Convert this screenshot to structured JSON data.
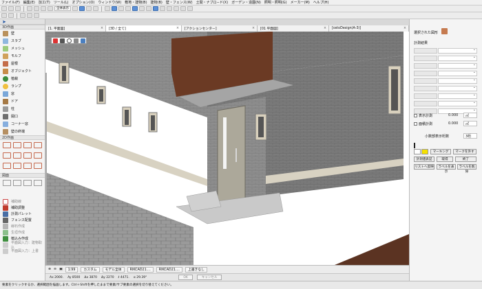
{
  "menu": [
    "ファイル(F)",
    "編集(E)",
    "加工(T)",
    "ツール(L)",
    "オプション(O)",
    "ウィンドウ(W)",
    "敷地・建物(B)",
    "建物(B)",
    "壁・フェンス(W)",
    "土間・ナブロ−ド(X)",
    "ガーデン・造園(N)",
    "照明・照明(G)",
    "メーカー(M)",
    "ヘルプ(H)"
  ],
  "toolbar": {
    "zoom_label": "全体表示"
  },
  "toolbox": {
    "header": "矢印",
    "section_3d": "3D作画",
    "tools_3d": [
      "壁",
      "スラブ",
      "メッシュ",
      "モルフ",
      "屋根",
      "オブジェクト",
      "植栽",
      "ランプ",
      "窓",
      "ドア",
      "柱",
      "開口",
      "コーナー窓",
      "壁の終端"
    ],
    "section_2d": "2D作画",
    "section_dim": "図面",
    "tools_bottom": [
      "補助線",
      "補助調整",
      "計測パレット",
      "フェンス配置",
      "線石作成",
      "生垣作成",
      "植込み作成",
      "平面図入力：建物取込",
      "平面図入力：上書"
    ]
  },
  "tabs": [
    {
      "label": "[1. 平面図]"
    },
    {
      "label": "[3D / 全て]"
    },
    {
      "label": "[アクションセンター]"
    },
    {
      "label": "[01 平面図]"
    },
    {
      "label": "[ostoDesign(A-3)]"
    }
  ],
  "rpanel": {
    "title": "選択された図形",
    "subtitle": "計測結果",
    "area_label": "表示計測",
    "area_value": "0.000",
    "area_unit": "㎡",
    "vol_label": "面積計測",
    "vol_value": "0.000",
    "vol_unit": "㎥",
    "decimals_label": "小数部表示桁数",
    "decimals_value": "3桁",
    "buttons": [
      "マーキング",
      "マークを外す",
      "計測値表記",
      "取得",
      "終了",
      "リストへ反映",
      "ラベルを表示",
      "ラベルを削除"
    ]
  },
  "bottom": {
    "scale": "1:99",
    "layer": "カスタム",
    "model": "モデル全体",
    "ex1": "RIKCAD21....",
    "ex2": "RIKCAD21....",
    "overwrite": "上書きなし",
    "ok": "OK",
    "cancel": "キャンセル"
  },
  "coords": {
    "ax": "Ax 2000.",
    "ay": "Ay 8500",
    "dx": "Δx 3870",
    "dy": "Δy 2270",
    "l": "ℓ 4471.",
    "a": "α 29.39°"
  },
  "status": "要素をクリックするか、選択範囲を描画します。Ctrl＋Shiftを押したままで要素/サブ要素の選択を切り替えてください。",
  "colors": {
    "wall": "#8f8f8f",
    "fascia": "#6b3a24",
    "door": "#aca89a",
    "ground": "#ffffff",
    "soil": "#5b3322",
    "accent": "#3a6db0"
  }
}
